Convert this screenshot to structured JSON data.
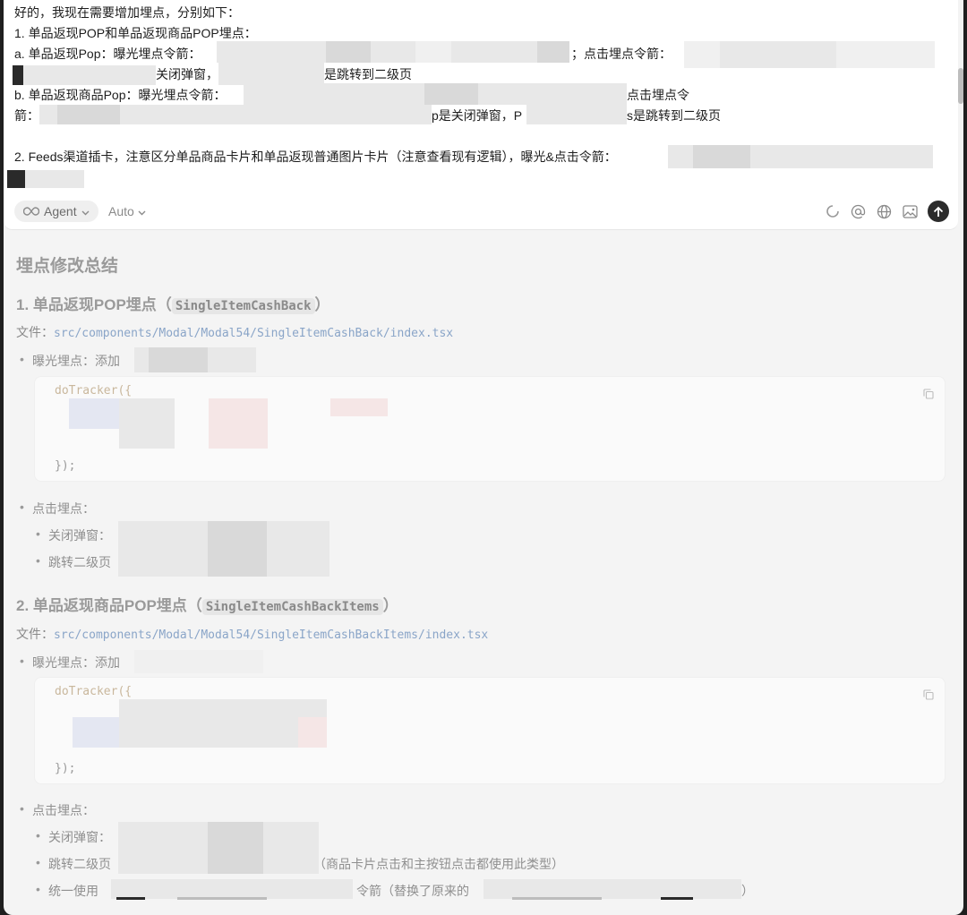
{
  "composer": {
    "lines": [
      "好的，我现在需要增加埋点，分别如下：",
      "1. 单品返现POP和单品返现商品POP埋点：",
      "a. 单品返现Pop：曝光埋点令箭：",
      "；点击埋点令箭：",
      "关闭弹窗，",
      "是跳转到二级页",
      "b. 单品返现商品Pop：曝光埋点令箭：",
      "点击埋点令",
      "箭：",
      "p是关闭弹窗，P",
      "s是跳转到二级页",
      "2. Feeds渠道插卡，注意区分单品商品卡片和单品返现普通图片卡片（注意查看现有逻辑），曝光&点击令箭："
    ],
    "mode_label": "Agent",
    "model_label": "Auto",
    "icons": [
      "agent-infinity-icon",
      "chevron-down-icon",
      "spinner-icon",
      "at-icon",
      "globe-icon",
      "image-icon",
      "send-arrow-icon"
    ]
  },
  "response": {
    "title": "埋点修改总结",
    "section1": {
      "heading_prefix": "1. 单品返现POP埋点（",
      "heading_code": "SingleItemCashBack",
      "heading_suffix": "）",
      "file_label": "文件：",
      "file_path": "src/components/Modal/Modal54/SingleItemCashBack/index.tsx",
      "expose_label": "曝光埋点：添加",
      "code_open": "doTracker({",
      "code_close": "});",
      "click_label": "点击埋点：",
      "close_label": "关闭弹窗：",
      "jump_label": "跳转二级页"
    },
    "section2": {
      "heading_prefix": "2. 单品返现商品POP埋点（",
      "heading_code": "SingleItemCashBackItems",
      "heading_suffix": "）",
      "file_label": "文件：",
      "file_path": "src/components/Modal/Modal54/SingleItemCashBackItems/index.tsx",
      "expose_label": "曝光埋点：添加",
      "code_open": "doTracker({",
      "code_close": "});",
      "click_label": "点击埋点：",
      "close_label": "关闭弹窗：",
      "jump_label": "跳转二级页",
      "jump_note": "（商品卡片点击和主按钮点击都使用此类型）",
      "unified_label": "统一使用",
      "unified_mid": "令箭（替换了原来的",
      "unified_end": "）"
    }
  }
}
